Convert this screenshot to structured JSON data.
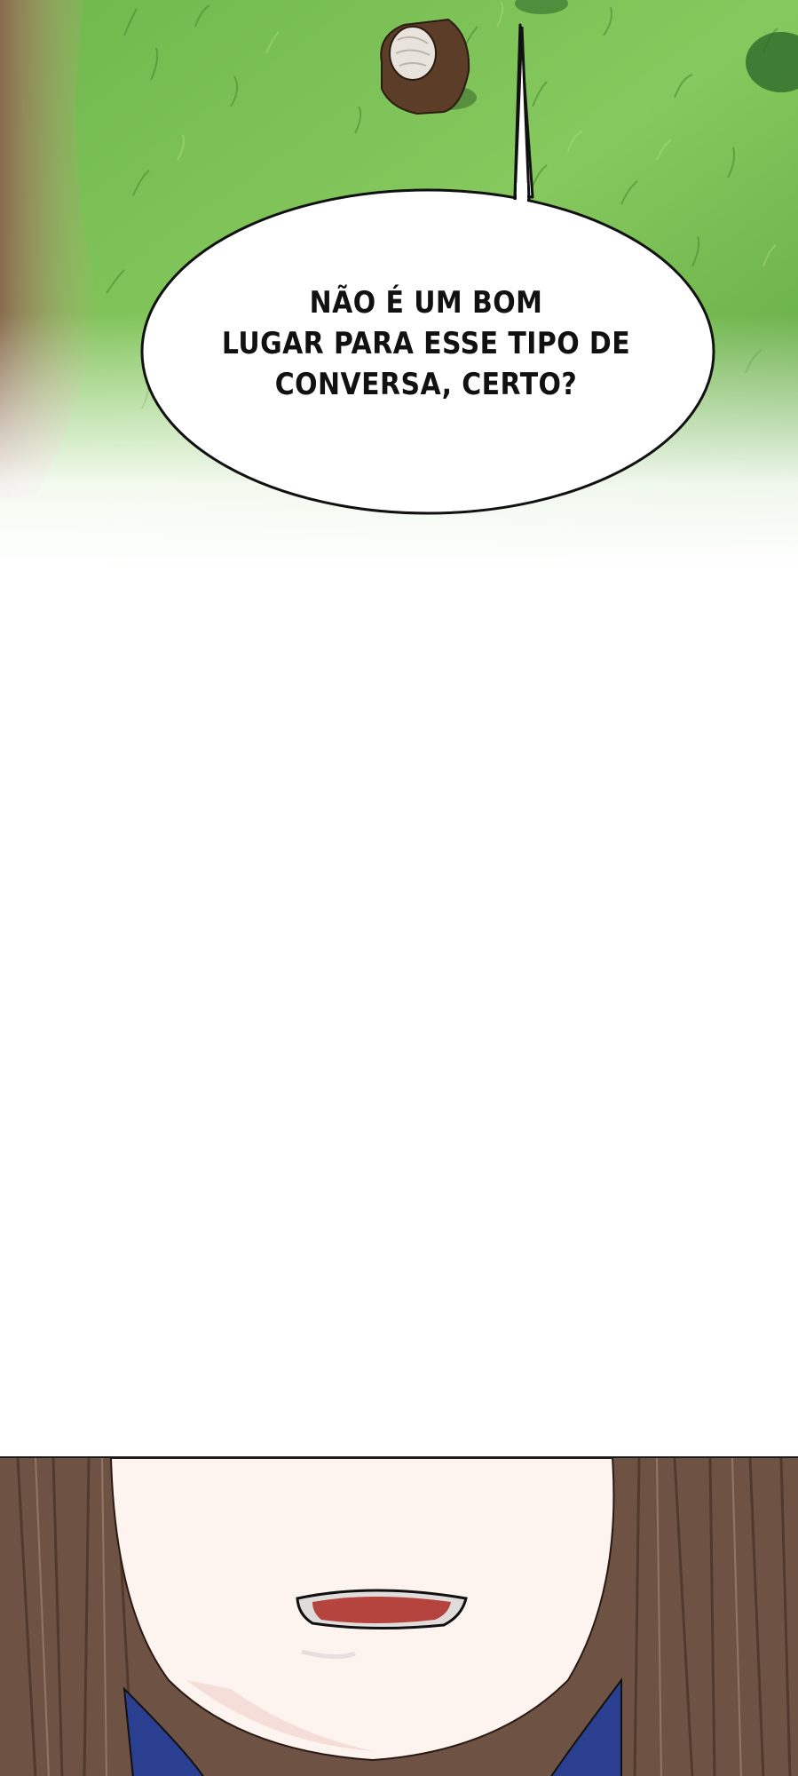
{
  "speech_bubble": {
    "text": "NÃO É UM BOM\nLUGAR PARA ESSE TIPO DE\nCONVERSA, CERTO?"
  },
  "colors": {
    "grass_light": "#7fc25a",
    "grass_dark": "#3f8a2e",
    "dirt_path": "#a08060",
    "bubble_fill": "#ffffff",
    "bubble_stroke": "#111111",
    "hair_brown": "#6e5244",
    "skin": "#fdf3ef",
    "mouth": "#b5443e",
    "collar_blue": "#2a3f8f"
  }
}
